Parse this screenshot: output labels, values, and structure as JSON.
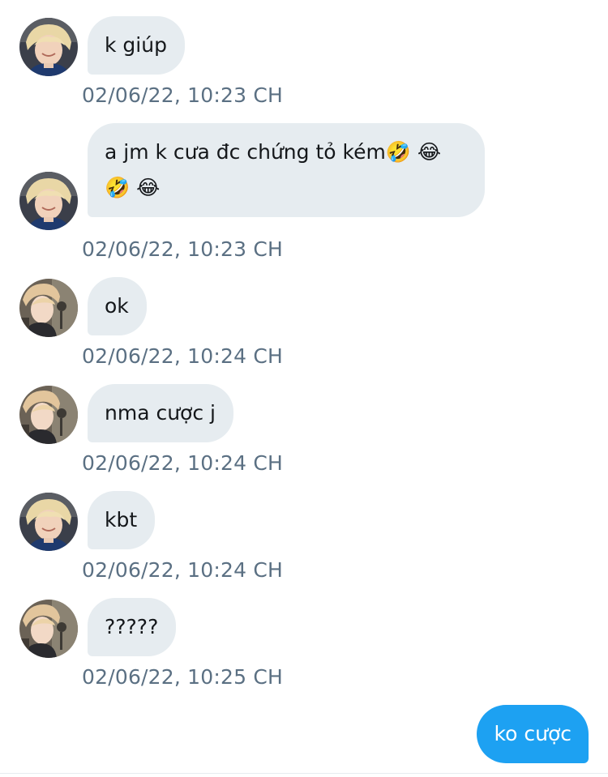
{
  "messages": [
    {
      "sender": "jimin",
      "text": "k giúp",
      "time": "02/06/22, 10:23 CH"
    },
    {
      "sender": "jimin",
      "text": "a jm k cưa đc chứng tỏ kém🤣 😂 🤣 😂",
      "time": "02/06/22, 10:23 CH"
    },
    {
      "sender": "other",
      "text": "ok",
      "time": "02/06/22, 10:24 CH"
    },
    {
      "sender": "other",
      "text": "nma cược j",
      "time": "02/06/22, 10:24 CH"
    },
    {
      "sender": "jimin",
      "text": "kbt",
      "time": "02/06/22, 10:24 CH"
    },
    {
      "sender": "other",
      "text": "?????",
      "time": "02/06/22, 10:25 CH"
    }
  ],
  "outgoing": {
    "text": "ko cược"
  },
  "colors": {
    "incoming_bubble": "#e6ecf0",
    "outgoing_bubble": "#1da1f2",
    "timestamp": "#5b7083"
  }
}
